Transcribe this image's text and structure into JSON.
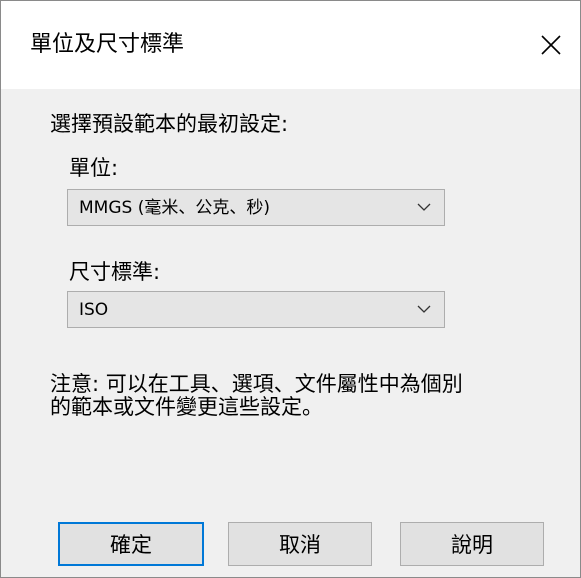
{
  "dialog": {
    "title": "單位及尺寸標準",
    "close_label": "×"
  },
  "form": {
    "prompt": "選擇預設範本的最初設定:",
    "units_label": "單位:",
    "units_value": "MMGS (毫米、公克、秒)",
    "standard_label": "尺寸標準:",
    "standard_value": "ISO",
    "note_line1": "注意: 可以在工具、選項、文件屬性中為個別",
    "note_line2": "的範本或文件變更這些設定。"
  },
  "buttons": {
    "ok": "確定",
    "cancel": "取消",
    "help": "說明"
  }
}
